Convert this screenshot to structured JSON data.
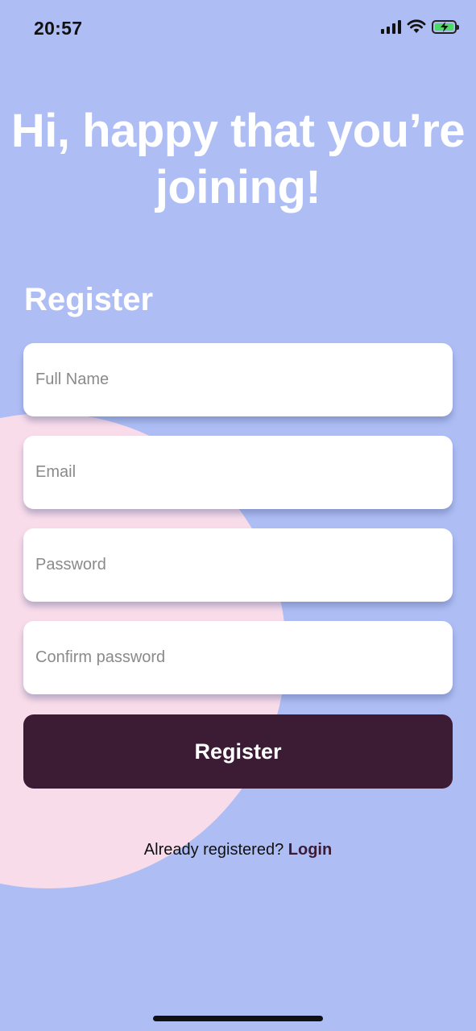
{
  "status_bar": {
    "time": "20:57",
    "icons": [
      "signal-icon",
      "wifi-icon",
      "battery-charging-icon"
    ]
  },
  "headline": {
    "line1": "Hi, happy that you’re",
    "line2": "joining!"
  },
  "form": {
    "title": "Register",
    "fields": {
      "full_name": {
        "placeholder": "Full Name",
        "value": ""
      },
      "email": {
        "placeholder": "Email",
        "value": ""
      },
      "password": {
        "placeholder": "Password",
        "value": ""
      },
      "confirm_password": {
        "placeholder": "Confirm password",
        "value": ""
      }
    },
    "submit_label": "Register"
  },
  "footer": {
    "prompt": "Already registered? ",
    "login_link": "Login"
  },
  "colors": {
    "background": "#AEBEF5",
    "blob": "#F9DCEA",
    "button": "#3C1B35",
    "text_light": "#FFFFFF"
  }
}
